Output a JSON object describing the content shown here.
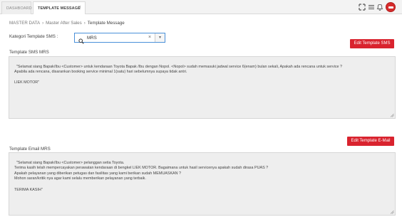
{
  "tabs": [
    {
      "label": "DASHBOARD"
    },
    {
      "label": "TEMPLATE MESSAGE",
      "close": "×"
    }
  ],
  "breadcrumb": [
    "MASTER DATA",
    "Master After Sales",
    "Template Message"
  ],
  "breadcrumb_sep": "›",
  "kategori": {
    "label": "Kategori Template SMS :",
    "value": "MRS",
    "clear": "×",
    "arrow": "▾"
  },
  "sms": {
    "button": "Edit Template SMS",
    "label": "Template SMS MRS",
    "text": "\"Selamat siang Bapak/Ibu <Customer> untuk kendaraan Toyota Bapak /Ibu dengan Nopol. <Nopol> sudah memasuki jadwal service 6(enam) bulan sekali, Apakah ada rencana untuk service ?\nApabila ada rencana, disarankan booking service minimal 1(satu) hari sebelumnya supaya tidak antri.\n\nLIEK MOTOR\""
  },
  "email": {
    "button": "Edit Template E-Mail",
    "label": "Template Email MRS",
    "text": "\"Selamat siang Bapak/Ibu <Customer> pelanggan setia Toyota.\nTerima kasih telah mempercayakan perawatan kendaraan di bengkel LIEK MOTOR. Bagaimana untuk hasil servicenya apakah sudah dirasa PUAS ?\nApakah pelayanan yang diberikan petugas dan fasilitas yang kami berikan sudah MEMUASKAN ?\nMohon saran/kritik nya agar kami selalu memberikan pelayanan yang terbaik.\n\nTERIMA KASIH\""
  },
  "icons": {
    "expand": "expand-icon",
    "menu": "menu-icon",
    "notification": "bell-icon",
    "avatar": "avatar"
  },
  "colors": {
    "accent_red": "#d9232e",
    "focus_blue": "#4a90d9"
  }
}
